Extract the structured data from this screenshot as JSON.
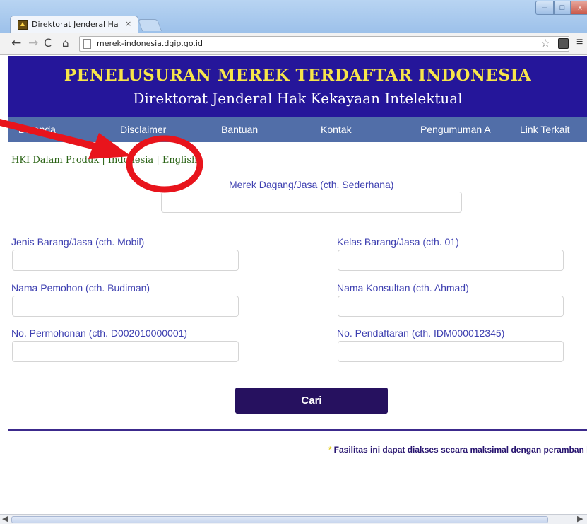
{
  "browser": {
    "tab_title": "Direktorat Jenderal Hak Ke",
    "tab_close": "×",
    "url": "merek-indonesia.dgip.go.id",
    "window_buttons": {
      "minimize": "–",
      "maximize": "□",
      "close": "x"
    }
  },
  "banner": {
    "title": "PENELUSURAN MEREK TERDAFTAR INDONESIA",
    "subtitle": "Direktorat Jenderal Hak Kekayaan Intelektual"
  },
  "nav": {
    "items": [
      {
        "label": "Beranda"
      },
      {
        "label": "Disclaimer"
      },
      {
        "label": "Bantuan"
      },
      {
        "label": "Kontak"
      },
      {
        "label": "Pengumuman A"
      },
      {
        "label": "Link Terkait"
      }
    ]
  },
  "subnav": {
    "hki": "HKI Dalam Produk",
    "sep1": " | ",
    "indonesia": "Indonesia",
    "sep2": " | ",
    "english": "English"
  },
  "form": {
    "merek_label": "Merek Dagang/Jasa (cth. Sederhana)",
    "jenis_label": "Jenis Barang/Jasa (cth. Mobil)",
    "kelas_label": "Kelas Barang/Jasa (cth. 01)",
    "pemohon_label": "Nama Pemohon (cth. Budiman)",
    "konsultan_label": "Nama Konsultan (cth. Ahmad)",
    "permohonan_label": "No. Permohonan (cth. D002010000001)",
    "pendaftaran_label": "No. Pendaftaran (cth. IDM000012345)",
    "search_button": "Cari"
  },
  "footer": {
    "asterisk": "*",
    "note": "Fasilitas ini dapat diakses secara maksimal dengan peramban l"
  },
  "colors": {
    "banner_bg": "#25169a",
    "banner_title": "#f7e54a",
    "navbar_bg": "#516ea8",
    "label_color": "#3d3fb0",
    "button_bg": "#26115f",
    "annotation_red": "#e8141c"
  },
  "annotation": {
    "type": "red-arrow-and-circle",
    "target": "English"
  }
}
